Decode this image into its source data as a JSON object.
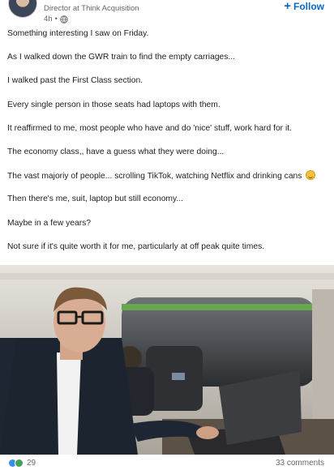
{
  "author": {
    "headline": "Director at Think Acquisition",
    "time": "4h",
    "separator": "•"
  },
  "actions": {
    "follow_icon": "+",
    "follow_label": "Follow"
  },
  "post": {
    "paragraphs": [
      "Something interesting I saw on Friday.",
      "As I walked down the GWR train to find the empty carriages...",
      "I walked past the First Class section.",
      "Every single person in those seats had laptops with them.",
      "It reaffirmed to me, most people who have and do 'nice' stuff, work hard for it.",
      "The economy class,, have a guess what they were doing...",
      "The vast majoriy of people... scrolling TikTok, watching Netflix and drinking cans",
      "Then there's me, suit, laptop but still economy...",
      "Maybe in a few years?",
      "Not sure if it's quite worth it for me, particularly at off peak quite times."
    ],
    "emoji": "grinning-face-with-sweat"
  },
  "social": {
    "reaction_count": "29",
    "comments": "33 comments"
  },
  "colors": {
    "follow_blue": "#0a66c2",
    "like_blue": "#378fe9",
    "celebrate_green": "#44a35a"
  }
}
